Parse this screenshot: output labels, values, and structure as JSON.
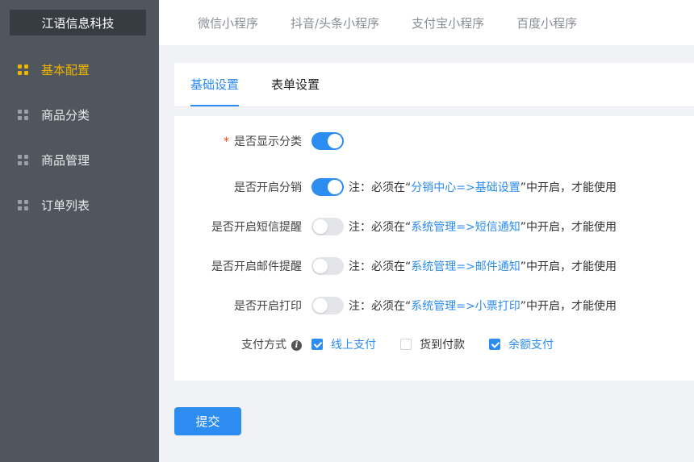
{
  "brand": "江语信息科技",
  "sidebar": {
    "items": [
      {
        "label": "基本配置",
        "active": true
      },
      {
        "label": "商品分类",
        "active": false
      },
      {
        "label": "商品管理",
        "active": false
      },
      {
        "label": "订单列表",
        "active": false
      }
    ]
  },
  "topnav": {
    "items": [
      "微信小程序",
      "抖音/头条小程序",
      "支付宝小程序",
      "百度小程序"
    ]
  },
  "tabs": {
    "basic": "基础设置",
    "form": "表单设置"
  },
  "form": {
    "show_category": {
      "label": "是否显示分类",
      "required_mark": "*",
      "enabled": true
    },
    "distribution": {
      "label": "是否开启分销",
      "enabled": true,
      "note_prefix": "注：必须在“",
      "note_link": "分销中心=>基础设置",
      "note_suffix": "”中开启，才能使用"
    },
    "sms": {
      "label": "是否开启短信提醒",
      "enabled": false,
      "note_prefix": "注：必须在“",
      "note_link": "系统管理=>短信通知",
      "note_suffix": "”中开启，才能使用"
    },
    "email": {
      "label": "是否开启邮件提醒",
      "enabled": false,
      "note_prefix": "注：必须在“",
      "note_link": "系统管理=>邮件通知",
      "note_suffix": "”中开启，才能使用"
    },
    "print": {
      "label": "是否开启打印",
      "enabled": false,
      "note_prefix": "注：必须在“",
      "note_link": "系统管理=>小票打印",
      "note_suffix": "”中开启，才能使用"
    },
    "payment": {
      "label": "支付方式",
      "options": [
        {
          "label": "线上支付",
          "checked": true
        },
        {
          "label": "货到付款",
          "checked": false
        },
        {
          "label": "余额支付",
          "checked": true
        }
      ]
    }
  },
  "submit_label": "提交",
  "colors": {
    "accent": "#2d8cf0",
    "active_menu": "#f0b400",
    "sidebar_bg": "#50565e"
  }
}
